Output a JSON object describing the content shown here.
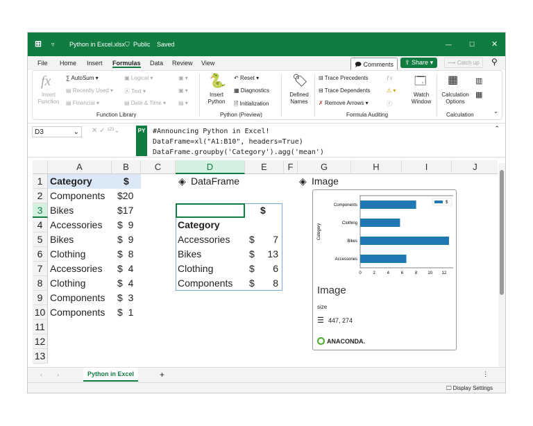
{
  "title": {
    "filename": "Python in Excel.xlsx",
    "visibility": "Public",
    "saved": "Saved"
  },
  "menu": [
    "File",
    "Home",
    "Insert",
    "Formulas",
    "Data",
    "Review",
    "View"
  ],
  "buttons": {
    "comments": "Comments",
    "share": "Share",
    "catch_up": "Catch up"
  },
  "ribbon": {
    "function_library": {
      "insert_function": "Insert Function",
      "autosum": "AutoSum",
      "recently_used": "Recently Used",
      "financial": "Financial",
      "logical": "Logical",
      "text": "Text",
      "date_time": "Date & Time",
      "label": "Function Library"
    },
    "python": {
      "insert_python": "Insert Python",
      "reset": "Reset",
      "diagnostics": "Diagnostics",
      "initialization": "Initialization",
      "label": "Python (Preview)"
    },
    "defined_names": "Defined Names",
    "auditing": {
      "trace_precedents": "Trace Precedents",
      "trace_dependents": "Trace Dependents",
      "remove_arrows": "Remove Arrows",
      "watch_window": "Watch Window",
      "label": "Formula Auditing"
    },
    "calculation": {
      "options": "Calculation Options",
      "label": "Calculation"
    }
  },
  "formula_bar": {
    "name_box": "D3",
    "py_badge": "PY",
    "lines": [
      "#Announcing Python in Excel!",
      "DataFrame=xl(\"A1:B10\", headers=True)",
      "DataFrame.groupby('Category').agg('mean')"
    ]
  },
  "columns": [
    "A",
    "B",
    "C",
    "D",
    "E",
    "F",
    "G",
    "H",
    "I",
    "J"
  ],
  "rows": [
    "1",
    "2",
    "3",
    "4",
    "5",
    "6",
    "7",
    "8",
    "9",
    "10",
    "11",
    "12",
    "13"
  ],
  "source": {
    "header": [
      "Category",
      "$"
    ],
    "data": [
      [
        "Components",
        "$20"
      ],
      [
        "Bikes",
        "$17"
      ],
      [
        "Accessories",
        "$  9"
      ],
      [
        "Bikes",
        "$  9"
      ],
      [
        "Clothing",
        "$  8"
      ],
      [
        "Accessories",
        "$  4"
      ],
      [
        "Clothing",
        "$  4"
      ],
      [
        "Components",
        "$  3"
      ],
      [
        "Components",
        "$  1"
      ]
    ]
  },
  "dataframe": {
    "title": "DataFrame",
    "col": "$",
    "index": "Category",
    "rows": [
      [
        "Accessories",
        "$",
        "7"
      ],
      [
        "Bikes",
        "$",
        "13"
      ],
      [
        "Clothing",
        "$",
        "6"
      ],
      [
        "Components",
        "$",
        "8"
      ]
    ]
  },
  "image": {
    "title": "Image",
    "card_title": "Image",
    "size_label": "size",
    "size": "447, 274",
    "brand": "ANACONDA."
  },
  "chart_data": {
    "type": "bar",
    "orientation": "horizontal",
    "categories": [
      "Accessories",
      "Bikes",
      "Clothing",
      "Components"
    ],
    "values": [
      6.6,
      12.7,
      5.7,
      8
    ],
    "ylabel": "Category",
    "xticks": [
      "0",
      "2",
      "4",
      "6",
      "8",
      "10",
      "12"
    ],
    "xlim": [
      0,
      13.5
    ],
    "legend": "$",
    "legend_position": "top-right",
    "color": "#1f77b4"
  },
  "sheet_tab": "Python in Excel",
  "status": {
    "display_settings": "Display Settings"
  },
  "colors": {
    "accent": "#107c41"
  }
}
